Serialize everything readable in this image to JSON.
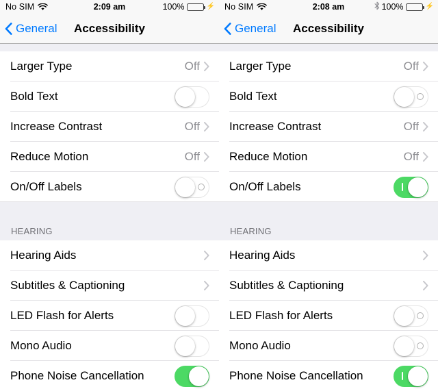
{
  "panels": [
    {
      "id": "left",
      "statusbar": {
        "carrier": "No SIM",
        "wifi_icon": "wifi-icon",
        "time": "2:09 am",
        "bluetooth_visible": false,
        "bluetooth_icon": "bluetooth-icon",
        "battery_percent": "100%",
        "battery_icon": "battery-full-charging-icon",
        "charging_icon": "lightning-bolt-icon",
        "battery_color": "#4cd964"
      },
      "navbar": {
        "back_icon": "chevron-left-icon",
        "back_label": "General",
        "title": "Accessibility",
        "tint_color": "#007aff"
      },
      "show_switch_labels": false,
      "groups": [
        {
          "header": "",
          "rows": [
            {
              "label": "Larger Type",
              "type": "disclosure",
              "value": "Off",
              "chevron_icon": "chevron-right-icon"
            },
            {
              "label": "Bold Text",
              "type": "switch",
              "on": false
            },
            {
              "label": "Increase Contrast",
              "type": "disclosure",
              "value": "Off",
              "chevron_icon": "chevron-right-icon"
            },
            {
              "label": "Reduce Motion",
              "type": "disclosure",
              "value": "Off",
              "chevron_icon": "chevron-right-icon"
            },
            {
              "label": "On/Off Labels",
              "type": "switch",
              "on": false,
              "force_labels": true
            }
          ]
        },
        {
          "header": "HEARING",
          "rows": [
            {
              "label": "Hearing Aids",
              "type": "disclosure",
              "value": "",
              "chevron_icon": "chevron-right-icon"
            },
            {
              "label": "Subtitles & Captioning",
              "type": "disclosure",
              "value": "",
              "chevron_icon": "chevron-right-icon"
            },
            {
              "label": "LED Flash for Alerts",
              "type": "switch",
              "on": false
            },
            {
              "label": "Mono Audio",
              "type": "switch",
              "on": false
            },
            {
              "label": "Phone Noise Cancellation",
              "type": "switch",
              "on": true
            }
          ]
        }
      ]
    },
    {
      "id": "right",
      "statusbar": {
        "carrier": "No SIM",
        "wifi_icon": "wifi-icon",
        "time": "2:08 am",
        "bluetooth_visible": true,
        "bluetooth_icon": "bluetooth-icon",
        "battery_percent": "100%",
        "battery_icon": "battery-full-charging-icon",
        "charging_icon": "lightning-bolt-icon",
        "battery_color": "#4cd964"
      },
      "navbar": {
        "back_icon": "chevron-left-icon",
        "back_label": "General",
        "title": "Accessibility",
        "tint_color": "#007aff"
      },
      "show_switch_labels": true,
      "groups": [
        {
          "header": "",
          "rows": [
            {
              "label": "Larger Type",
              "type": "disclosure",
              "value": "Off",
              "chevron_icon": "chevron-right-icon"
            },
            {
              "label": "Bold Text",
              "type": "switch",
              "on": false
            },
            {
              "label": "Increase Contrast",
              "type": "disclosure",
              "value": "Off",
              "chevron_icon": "chevron-right-icon"
            },
            {
              "label": "Reduce Motion",
              "type": "disclosure",
              "value": "Off",
              "chevron_icon": "chevron-right-icon"
            },
            {
              "label": "On/Off Labels",
              "type": "switch",
              "on": true
            }
          ]
        },
        {
          "header": "HEARING",
          "rows": [
            {
              "label": "Hearing Aids",
              "type": "disclosure",
              "value": "",
              "chevron_icon": "chevron-right-icon"
            },
            {
              "label": "Subtitles & Captioning",
              "type": "disclosure",
              "value": "",
              "chevron_icon": "chevron-right-icon"
            },
            {
              "label": "LED Flash for Alerts",
              "type": "switch",
              "on": false
            },
            {
              "label": "Mono Audio",
              "type": "switch",
              "on": false
            },
            {
              "label": "Phone Noise Cancellation",
              "type": "switch",
              "on": true
            }
          ]
        }
      ]
    }
  ]
}
